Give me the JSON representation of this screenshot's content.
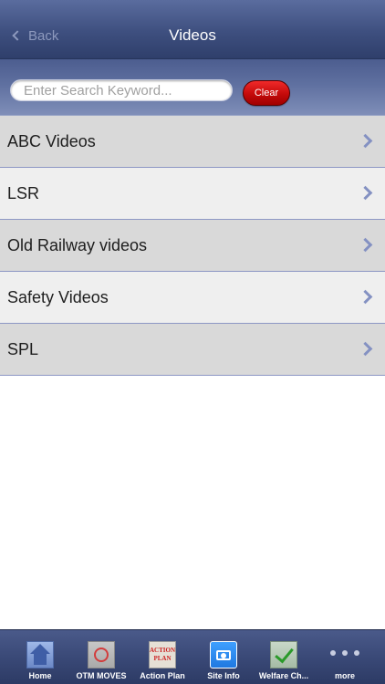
{
  "navbar": {
    "back_label": "Back",
    "title": "Videos"
  },
  "search": {
    "placeholder": "Enter Search Keyword...",
    "value": "",
    "clear_label": "Clear"
  },
  "list": {
    "items": [
      {
        "label": "ABC Videos"
      },
      {
        "label": "LSR"
      },
      {
        "label": "Old Railway videos"
      },
      {
        "label": "Safety Videos"
      },
      {
        "label": "SPL"
      }
    ]
  },
  "tabbar": {
    "tabs": [
      {
        "label": "Home",
        "icon": "home-icon"
      },
      {
        "label": "OTM MOVES",
        "icon": "otm-moves-icon"
      },
      {
        "label": "Action Plan",
        "icon": "action-plan-icon",
        "icon_text": "ACTION PLAN"
      },
      {
        "label": "Site Info",
        "icon": "camera-icon",
        "selected": true
      },
      {
        "label": "Welfare Ch...",
        "icon": "checkmark-icon"
      },
      {
        "label": "more",
        "icon": "more-icon"
      }
    ]
  },
  "colors": {
    "navbar": "#3e4f7f",
    "clear_button": "#c40a0a",
    "list_divider": "#8d97c4",
    "chevron": "#8491c2"
  }
}
